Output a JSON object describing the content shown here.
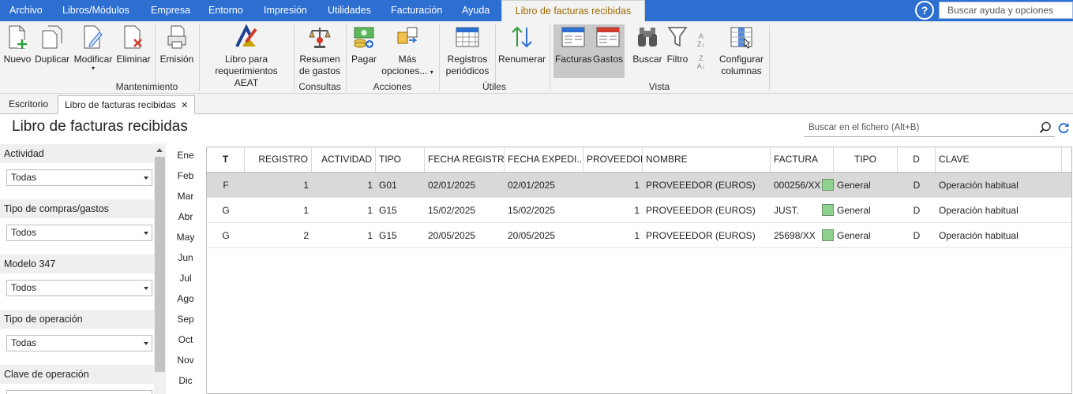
{
  "menu": {
    "items": [
      "Archivo",
      "Libros/Módulos",
      "Empresa",
      "Entorno",
      "Impresión",
      "Utilidades",
      "Facturación",
      "Ayuda"
    ],
    "active_tab": "Libro de facturas recibidas",
    "help_icon": "?",
    "help_search_placeholder": "Buscar ayuda y opciones"
  },
  "ribbon": {
    "nuevo": "Nuevo",
    "duplicar": "Duplicar",
    "modificar": "Modificar",
    "eliminar": "Eliminar",
    "emision": "Emisión",
    "libro_aeat_1": "Libro para",
    "libro_aeat_2": "requerimientos AEAT",
    "resumen_1": "Resumen",
    "resumen_2": "de gastos",
    "pagar": "Pagar",
    "mas_1": "Más",
    "mas_2": "opciones...",
    "registros_1": "Registros",
    "registros_2": "periódicos",
    "renumerar": "Renumerar",
    "facturas": "Facturas",
    "gastos": "Gastos",
    "buscar": "Buscar",
    "filtro": "Filtro",
    "configurar_1": "Configurar",
    "configurar_2": "columnas",
    "groups": {
      "mantenimiento": "Mantenimiento",
      "consultas": "Consultas",
      "acciones": "Acciones",
      "utiles": "Útiles",
      "vista": "Vista"
    }
  },
  "tabs": {
    "escritorio": "Escritorio",
    "libro": "Libro de facturas recibidas",
    "close": "✕"
  },
  "page_title": "Libro de facturas recibidas",
  "file_search_placeholder": "Buscar en el fichero (Alt+B)",
  "filters": [
    {
      "label": "Actividad",
      "value": "Todas"
    },
    {
      "label": "Tipo de compras/gastos",
      "value": "Todos"
    },
    {
      "label": "Modelo 347",
      "value": "Todos"
    },
    {
      "label": "Tipo de operación",
      "value": "Todas"
    },
    {
      "label": "Clave de operación",
      "value": ""
    }
  ],
  "months": [
    "Ene",
    "Feb",
    "Mar",
    "Abr",
    "May",
    "Jun",
    "Jul",
    "Ago",
    "Sep",
    "Oct",
    "Nov",
    "Dic"
  ],
  "grid": {
    "headers": [
      "T",
      "REGISTRO",
      "ACTIVIDAD",
      "TIPO",
      "FECHA REGISTRO",
      "FECHA EXPEDI...",
      "PROVEEDOR",
      "NOMBRE",
      "FACTURA",
      "TIPO",
      "D",
      "CLAVE"
    ],
    "rows": [
      {
        "t": "F",
        "registro": "1",
        "actividad": "1",
        "tipo": "G01",
        "fecha_registro": "02/01/2025",
        "fecha_expedicion": "02/01/2025",
        "proveedor": "1",
        "nombre": "PROVEEEDOR (EUROS)",
        "factura": "000256/XX",
        "tipo2": "General",
        "d": "D",
        "clave": "Operación habitual"
      },
      {
        "t": "G",
        "registro": "1",
        "actividad": "1",
        "tipo": "G15",
        "fecha_registro": "15/02/2025",
        "fecha_expedicion": "15/02/2025",
        "proveedor": "1",
        "nombre": "PROVEEEDOR (EUROS)",
        "factura": "JUST.",
        "tipo2": "General",
        "d": "D",
        "clave": "Operación habitual"
      },
      {
        "t": "G",
        "registro": "2",
        "actividad": "1",
        "tipo": "G15",
        "fecha_registro": "20/05/2025",
        "fecha_expedicion": "20/05/2025",
        "proveedor": "1",
        "nombre": "PROVEEEDOR (EUROS)",
        "factura": "25698/XX",
        "tipo2": "General",
        "d": "D",
        "clave": "Operación habitual"
      }
    ]
  },
  "colors": {
    "menubar": "#2d6ed1",
    "ribbon": "#f3f3f3",
    "active_tab_text": "#9a6a00",
    "selected_row": "#d9d9d9"
  }
}
